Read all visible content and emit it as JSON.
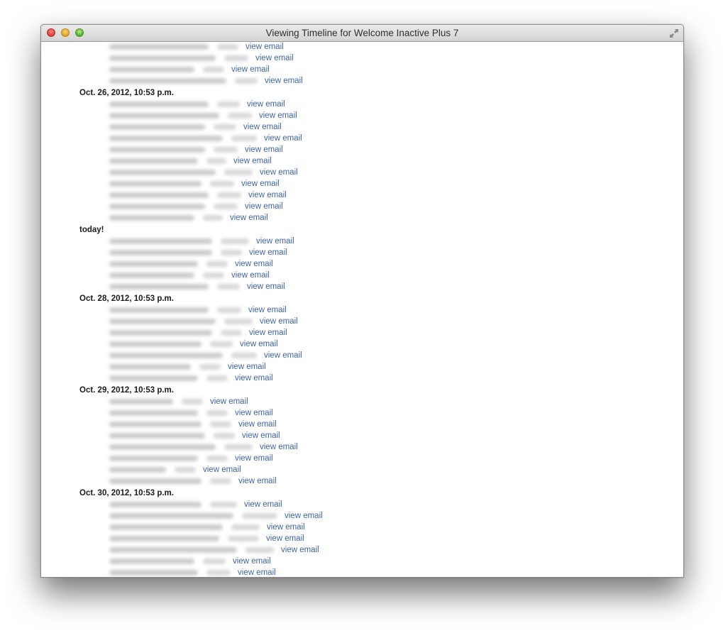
{
  "window": {
    "title": "Viewing Timeline for Welcome Inactive Plus 7"
  },
  "link_label": "view email",
  "groups": [
    {
      "heading": "",
      "rows": [
        {
          "em": 140,
          "num": 30
        },
        {
          "em": 150,
          "num": 34
        },
        {
          "em": 120,
          "num": 30
        },
        {
          "em": 165,
          "num": 32
        }
      ]
    },
    {
      "heading": "Oct. 26, 2012, 10:53 p.m.",
      "rows": [
        {
          "em": 140,
          "num": 32
        },
        {
          "em": 155,
          "num": 34
        },
        {
          "em": 135,
          "num": 32
        },
        {
          "em": 160,
          "num": 36
        },
        {
          "em": 135,
          "num": 34
        },
        {
          "em": 125,
          "num": 28
        },
        {
          "em": 150,
          "num": 40
        },
        {
          "em": 130,
          "num": 34
        },
        {
          "em": 140,
          "num": 34
        },
        {
          "em": 135,
          "num": 34
        },
        {
          "em": 120,
          "num": 28
        }
      ]
    },
    {
      "heading": "today!",
      "rows": [
        {
          "em": 145,
          "num": 40
        },
        {
          "em": 145,
          "num": 30
        },
        {
          "em": 125,
          "num": 30
        },
        {
          "em": 120,
          "num": 30
        },
        {
          "em": 140,
          "num": 32
        }
      ]
    },
    {
      "heading": "Oct. 28, 2012, 10:53 p.m.",
      "rows": [
        {
          "em": 140,
          "num": 34
        },
        {
          "em": 150,
          "num": 40
        },
        {
          "em": 145,
          "num": 30
        },
        {
          "em": 130,
          "num": 32
        },
        {
          "em": 160,
          "num": 36
        },
        {
          "em": 115,
          "num": 30
        },
        {
          "em": 125,
          "num": 30
        }
      ]
    },
    {
      "heading": "Oct. 29, 2012, 10:53 p.m.",
      "rows": [
        {
          "em": 90,
          "num": 30
        },
        {
          "em": 125,
          "num": 30
        },
        {
          "em": 130,
          "num": 30
        },
        {
          "em": 135,
          "num": 30
        },
        {
          "em": 150,
          "num": 40
        },
        {
          "em": 125,
          "num": 30
        },
        {
          "em": 80,
          "num": 30
        },
        {
          "em": 130,
          "num": 30
        }
      ]
    },
    {
      "heading": "Oct. 30, 2012, 10:53 p.m.",
      "rows": [
        {
          "em": 130,
          "num": 38
        },
        {
          "em": 175,
          "num": 50
        },
        {
          "em": 160,
          "num": 40
        },
        {
          "em": 155,
          "num": 44
        },
        {
          "em": 180,
          "num": 40
        },
        {
          "em": 120,
          "num": 32
        },
        {
          "em": 125,
          "num": 34
        }
      ]
    }
  ]
}
